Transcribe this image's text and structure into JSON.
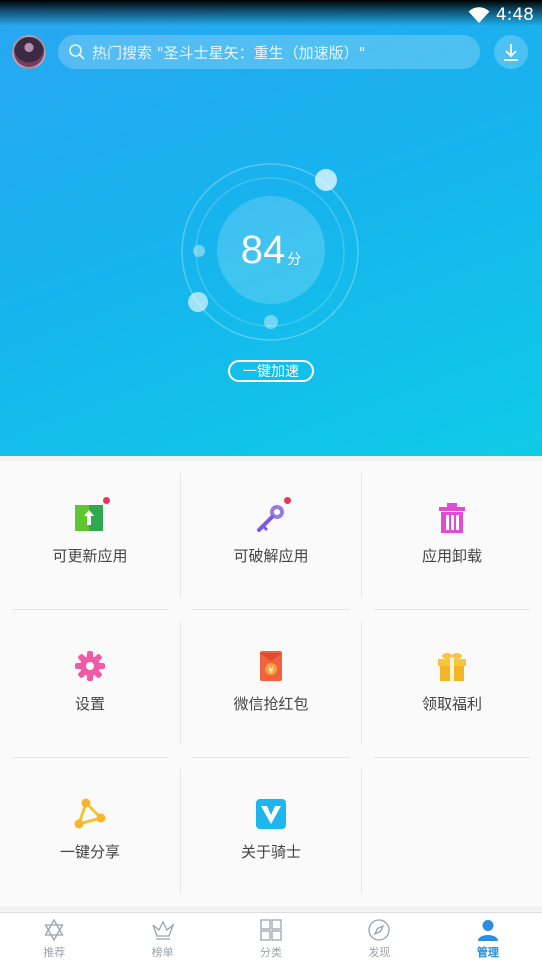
{
  "status": {
    "time": "4:48"
  },
  "search": {
    "placeholder": "热门搜索 \"圣斗士星矢：重生（加速版）\""
  },
  "score": {
    "value": "84",
    "unit": "分"
  },
  "accelerate_label": "一键加速",
  "grid": {
    "items": [
      {
        "label": "可更新应用",
        "icon": "update-icon"
      },
      {
        "label": "可破解应用",
        "icon": "key-icon"
      },
      {
        "label": "应用卸载",
        "icon": "trash-icon"
      },
      {
        "label": "设置",
        "icon": "gear-icon"
      },
      {
        "label": "微信抢红包",
        "icon": "red-envelope-icon"
      },
      {
        "label": "领取福利",
        "icon": "gift-icon"
      },
      {
        "label": "一键分享",
        "icon": "share-icon"
      },
      {
        "label": "关于骑士",
        "icon": "knight-logo-icon"
      }
    ]
  },
  "tabs": [
    {
      "label": "推荐",
      "icon": "star-icon"
    },
    {
      "label": "榜单",
      "icon": "crown-icon"
    },
    {
      "label": "分类",
      "icon": "grid-icon"
    },
    {
      "label": "发现",
      "icon": "compass-icon"
    },
    {
      "label": "管理",
      "icon": "person-icon",
      "active": true
    }
  ],
  "colors": {
    "hero_start": "#2aa6f1",
    "hero_end": "#0fcbe6",
    "active_tab": "#2a8fe0"
  }
}
